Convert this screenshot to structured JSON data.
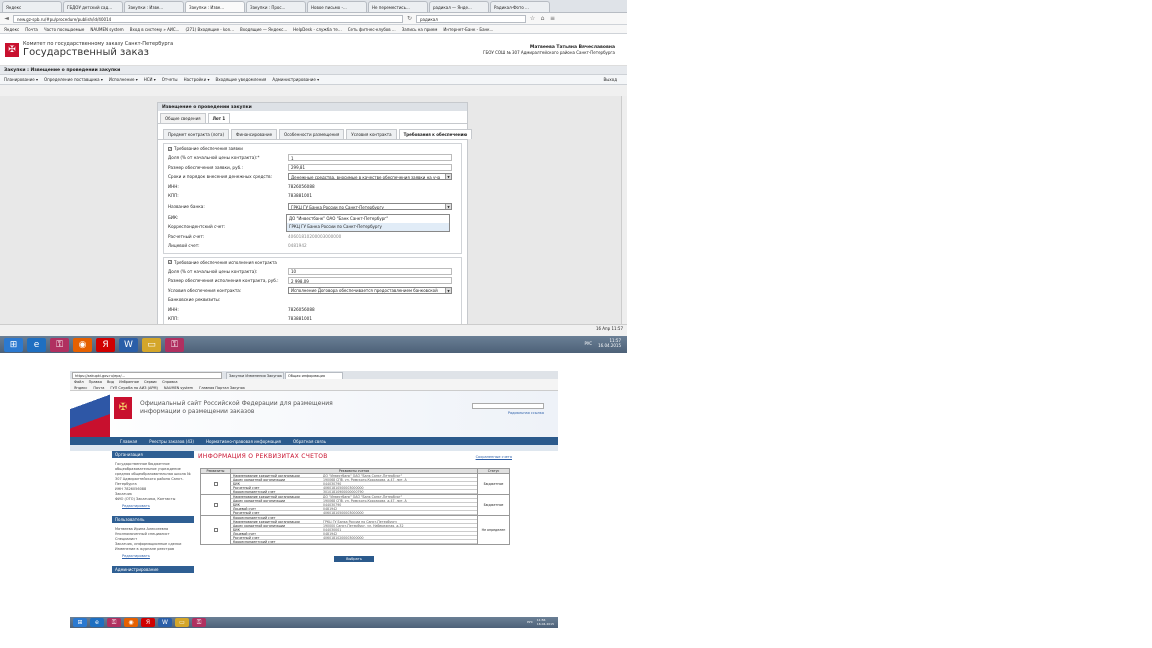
{
  "shot1": {
    "tabs": [
      "Яндекс",
      "ГБДОУ детский сад...",
      "Закупки : Изве...",
      "Закупки : Изве...",
      "Закупки : Прос...",
      "Новое письмо -...",
      "Не переместись...",
      "радикал — Янде...",
      "Радикал-Фото ..."
    ],
    "url": "new.gz-spb.ru/#pu/procedure/publish/id/40014",
    "search": "радикал",
    "bookmarks": [
      "Яндекс",
      "Почта",
      "Часто посещаемые",
      "NAUMEN system",
      "Вход в систему » АИС...",
      "(271) Входящие - kon...",
      "Входящие — Яндекс...",
      "HelpDesk - служба те...",
      "Сеть фитнес-клубов ...",
      "Запись на прием",
      "Интернет-Банк - Банк..."
    ],
    "org_line1": "Комитет по государственному заказу Санкт-Петербурга",
    "org_line2": "Государственный заказ",
    "user_name": "Матвеева Татьяна Вячеславовна",
    "user_org": "ГБОУ СОШ № 307 Адмиралтейского района Санкт-Петербурга",
    "page_title": "Закупки : Извещение о проведении закупки",
    "menu": [
      "Планирование ▾",
      "Определение поставщика ▾",
      "Исполнение ▾",
      "НСИ ▾",
      "Отчеты",
      "Настройки ▾",
      "Входящие уведомления",
      "Администрирование ▾"
    ],
    "exit_label": "Выход",
    "panel_title": "Извещение о проведении закупки",
    "panel_tabs": [
      "Общие сведения",
      "Лот 1"
    ],
    "sub_tabs": [
      "Предмет контракта (лота)",
      "Финансирование",
      "Особенности размещения",
      "Условия контракта",
      "Требования к обеспечению"
    ],
    "bid_section": {
      "legend": "Требование обеспечения заявки",
      "share_label": "Доля (% от начальной цены контракта):*",
      "share_value": "1",
      "amount_label": "Размер обеспечения заявки, руб.:",
      "amount_value": "299,81",
      "terms_label": "Сроки и порядок внесения денежных средств:",
      "terms_value": "Денежные средства, вносимые в качестве обеспечения заявки на уча",
      "inn_label": "ИНН:",
      "inn_value": "7826056088",
      "kpp_label": "КПП:",
      "kpp_value": "783881001",
      "bank_label": "Название банка:",
      "bank_value": "ГРКЦ ГУ Банка России по Санкт-Петербургу",
      "bik_label": "БИК:",
      "corr_label": "Корреспондентский счет:",
      "account_label": "Расчетный счет:",
      "account_value": "40601810200003000000",
      "personal_label": "Лицевой счет:",
      "personal_value": "0481942",
      "bank_options": [
        "ДО \"Инвестбанк\" ОАО \"Банк Санкт-Петербург\"",
        "ГРКЦ ГУ Банка России по Санкт-Петербургу"
      ]
    },
    "contract_section": {
      "legend": "Требование обеспечения исполнения контракта",
      "share_label": "Доля (% от начальной цены контракта):",
      "share_value": "10",
      "amount_label": "Размер обеспечения исполнения контракта, руб.:",
      "amount_value": "2 998,09",
      "terms_label": "Условия обеспечения контракта:",
      "terms_value": "Исполнение Договора обеспечивается предоставлением банковской",
      "req_label": "Банковские реквизиты:",
      "inn_label": "ИНН:",
      "inn_value": "7826056088",
      "kpp_label": "КПП:",
      "kpp_value": "783881001"
    },
    "status_right": "16 Апр 11:57",
    "tray_lang": "РУС",
    "tray_time": "11:57",
    "tray_date": "16.04.2015"
  },
  "shot2": {
    "url": "https://zakupki.gov.ru/epz/...",
    "tabs": [
      "Закупки Изменения Закупок",
      "Общая информация"
    ],
    "menu": [
      "Файл",
      "Правка",
      "Вид",
      "Избранное",
      "Сервис",
      "Справка"
    ],
    "bookmarks": [
      "Яндекс",
      "Почта",
      "ГУП Служба по АИЗ (АРМ)",
      "NAUMEN system",
      "Главная Портал Закупок"
    ],
    "site_title_1": "Официальный сайт Российской Федерации для размещения",
    "site_title_2": "информации о размещении заказов",
    "site_links": "Радиальная ссылка",
    "nav": [
      "Главная",
      "Реестры заказов (43)",
      "Нормативно-правовая информация",
      "Обратная связь"
    ],
    "sidebar": {
      "org_head": "Организация",
      "org_text": [
        "Государственное бюджетное общеобразовательное учреждение средняя общеобразовательная школа № 307 Адмиралтейского района Санкт-Петербурга",
        "ИНН 7826056088",
        "Заказчик",
        "ФИО (ОТО) Заказчика, Контакты"
      ],
      "org_link": "Редактировать",
      "user_head": "Пользователь",
      "user_text": [
        "Матвеева Ирина Алексеевна",
        "Уполномоченный специалист",
        "Специалист",
        "Заказчик, информационные сделки",
        "Изменение в журнале реестров"
      ],
      "user_link": "Редактировать",
      "admin_head": "Администрирование"
    },
    "main_title": "ИНФОРМАЦИЯ О РЕКВИЗИТАХ СЧЕТОВ",
    "add_link": "Сохраненные счета",
    "table_headers": [
      "Реквизиты",
      "Реквизиты счетов",
      "Статус"
    ],
    "rows": [
      {
        "status": "Бюджетное",
        "fields": [
          [
            "Наименование кредитной организации",
            "ДО \"Инвестбанк\" ОАО \"Банк Санкт-Петербург\""
          ],
          [
            "Адрес кредитной организации",
            "190068 СПб, ул. Римского-Корсакова, д.47, лит. А"
          ],
          [
            "БИК",
            "044030790"
          ],
          [
            "Расчетный счет",
            "40601810500003000000"
          ],
          [
            "Корреспондентский счет",
            "30101810900000000790"
          ]
        ]
      },
      {
        "status": "Бюджетное",
        "fields": [
          [
            "Наименование кредитной организации",
            "ДО \"Инвестбанк\" ОАО \"Банк Санкт-Петербург\""
          ],
          [
            "Адрес кредитной организации",
            "190068 СПб, ул. Римского-Корсакова, д.47, лит. А"
          ],
          [
            "БИК",
            "044030790"
          ],
          [
            "Лицевой счет",
            "0481942"
          ],
          [
            "Расчетный счет",
            "40601810500003000000"
          ]
        ]
      },
      {
        "status": "Не определен",
        "fields": [
          [
            "Корреспондентский счет",
            ""
          ],
          [
            "Наименование кредитной организации",
            "ГРКЦ ГУ Банка России по Санкт-Петербургу"
          ],
          [
            "Адрес кредитной организации",
            "190000 Санкт-Петербург, ул. Набережная, д.32"
          ],
          [
            "БИК",
            "044030001"
          ],
          [
            "Лицевой счет",
            "0481942"
          ],
          [
            "Расчетный счет",
            "40601810200003000000"
          ],
          [
            "Корреспондентский счет",
            ""
          ]
        ]
      }
    ],
    "select_button": "Выбрать",
    "tray_lang": "РУС",
    "tray_time": "11:56",
    "tray_date": "16.04.2015"
  }
}
